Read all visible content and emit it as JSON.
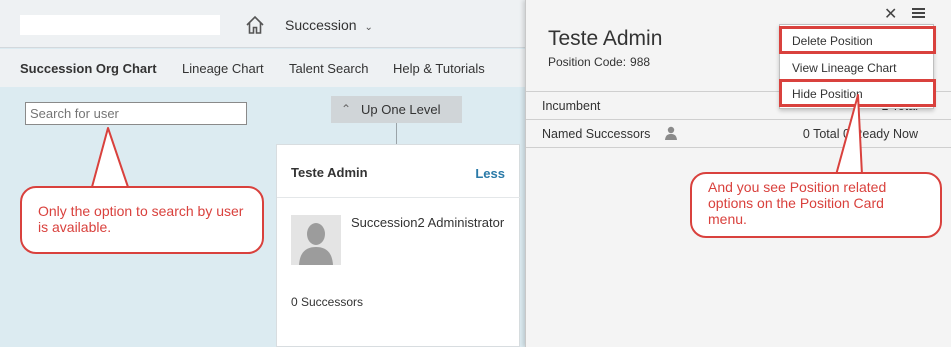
{
  "topbar": {
    "module_label": "Succession"
  },
  "subnav": {
    "tabs": [
      {
        "label": "Succession Org Chart",
        "active": true
      },
      {
        "label": "Lineage Chart",
        "active": false
      },
      {
        "label": "Talent Search",
        "active": false
      },
      {
        "label": "Help & Tutorials",
        "active": false
      }
    ]
  },
  "search": {
    "placeholder": "Search for user"
  },
  "org_chart": {
    "up_level_label": "Up One Level",
    "card": {
      "name": "Teste Admin",
      "toggle_label": "Less",
      "title": "Succession2 Administrator",
      "successors": "0 Successors"
    }
  },
  "position_panel": {
    "title": "Teste Admin",
    "code_label": "Position Code:",
    "code_value": "988",
    "rows": [
      {
        "label": "Incumbent",
        "right": "1 Total"
      },
      {
        "label": "Named Successors",
        "right": "0 Total 0 Ready Now"
      }
    ],
    "menu": [
      {
        "label": "Delete Position",
        "highlighted": true
      },
      {
        "label": "View Lineage Chart",
        "highlighted": false
      },
      {
        "label": "Hide Position",
        "highlighted": true
      }
    ]
  },
  "annotations": {
    "left": "Only the option to search by user is available.",
    "right": "And you see Position related options on the Position Card menu."
  },
  "colors": {
    "accent_link": "#2a7aa8",
    "annotation_red": "#d9413d",
    "background": "#dcebf1"
  }
}
